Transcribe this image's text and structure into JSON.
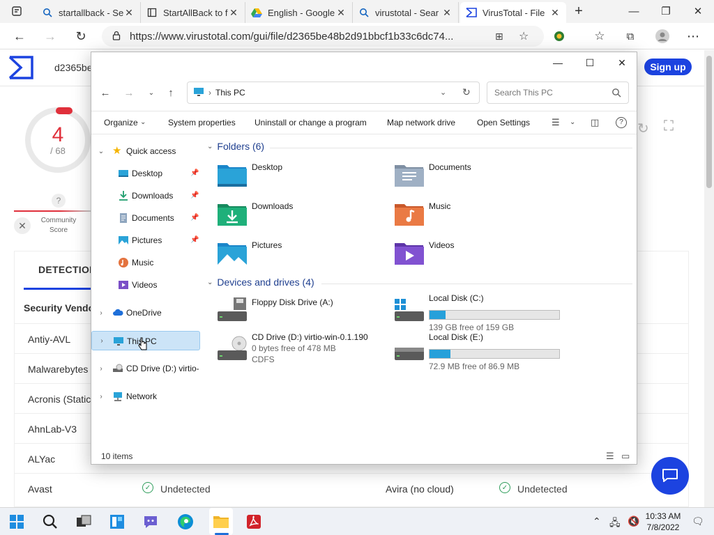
{
  "browser": {
    "tabs": [
      {
        "label": "startallback - Se",
        "icon": "search-icon",
        "active": false
      },
      {
        "label": "StartAllBack to fi",
        "icon": "page-icon",
        "active": false
      },
      {
        "label": "English - Google",
        "icon": "google-drive-icon",
        "active": false
      },
      {
        "label": "virustotal - Sear",
        "icon": "search-icon",
        "active": false
      },
      {
        "label": "VirusTotal - File",
        "icon": "virustotal-icon",
        "active": true
      }
    ],
    "url": "https://www.virustotal.com/gui/file/d2365be48b2d91bbcf1b33c6dc74..."
  },
  "virustotal": {
    "hash_prefix": "d2365be",
    "signup_label": "Sign up",
    "score": {
      "detections": "4",
      "total": "/ 68"
    },
    "community_qmark": "?",
    "community_label": "Community Score",
    "detection_tab": "DETECTION",
    "security_vendors_label": "Security Vendo",
    "vendors": [
      {
        "name": "Antiy-AVL"
      },
      {
        "name": "Malwarebytes"
      },
      {
        "name": "Acronis (Static"
      },
      {
        "name": "AhnLab-V3"
      },
      {
        "name": "ALYac"
      },
      {
        "name": "Avast",
        "result": "Undetected",
        "vendor2": "Avira (no cloud)",
        "result2": "Undetected"
      }
    ]
  },
  "explorer": {
    "address": "This PC",
    "search_placeholder": "Search This PC",
    "commands": {
      "organize": "Organize",
      "system_properties": "System properties",
      "uninstall": "Uninstall or change a program",
      "map_drive": "Map network drive",
      "open_settings": "Open Settings"
    },
    "nav": {
      "quick_access": "Quick access",
      "desktop": "Desktop",
      "downloads": "Downloads",
      "documents": "Documents",
      "pictures": "Pictures",
      "music": "Music",
      "videos": "Videos",
      "onedrive": "OneDrive",
      "this_pc": "This PC",
      "cd_drive": "CD Drive (D:) virtio-w",
      "network": "Network"
    },
    "folders_header": "Folders (6)",
    "folders": {
      "desktop": "Desktop",
      "documents": "Documents",
      "downloads": "Downloads",
      "music": "Music",
      "pictures": "Pictures",
      "videos": "Videos"
    },
    "devices_header": "Devices and drives (4)",
    "drives": {
      "floppy": {
        "name": "Floppy Disk Drive (A:)"
      },
      "c": {
        "name": "Local Disk (C:)",
        "free": "139 GB free of 159 GB",
        "used_fraction": 0.126
      },
      "d": {
        "name": "CD Drive (D:) virtio-win-0.1.190",
        "free": "0 bytes free of 478 MB",
        "fs": "CDFS"
      },
      "e": {
        "name": "Local Disk (E:)",
        "free": "72.9 MB free of 86.9 MB",
        "used_fraction": 0.161
      }
    },
    "status": "10 items"
  },
  "taskbar": {
    "time": "10:33 AM",
    "date": "7/8/2022"
  }
}
